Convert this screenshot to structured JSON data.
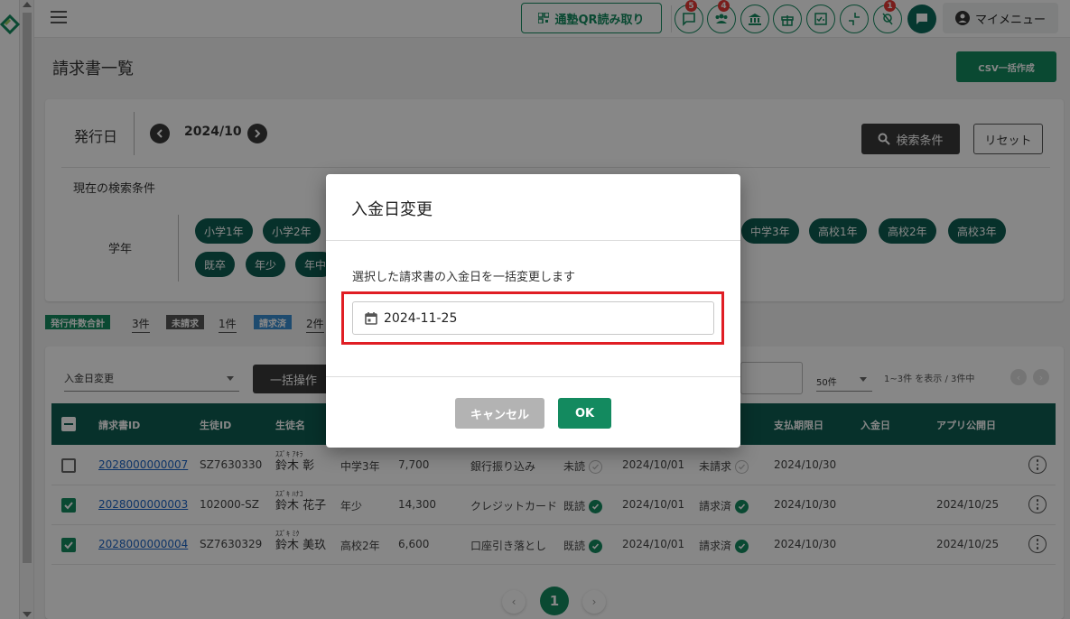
{
  "header": {
    "qr_button": "通塾QR読み取り",
    "badges": {
      "messages": "5",
      "users": "4",
      "alerts": "1"
    },
    "my_menu": "マイメニュー"
  },
  "page": {
    "title": "請求書一覧",
    "csv_button": "CSV一括作成"
  },
  "filters": {
    "issue_date_label": "発行日",
    "month": "2024/10",
    "search_button": "検索条件",
    "reset_button": "リセット",
    "current_conditions_label": "現在の検索条件",
    "grade_label": "学年",
    "chips_row1": [
      "小学1年",
      "小学2年",
      "中学3年",
      "高校1年",
      "高校2年",
      "高校3年"
    ],
    "chips_row2": [
      "既卒",
      "年少",
      "年中"
    ]
  },
  "summary": {
    "issued_label": "発行件数合計",
    "issued_value": "3件",
    "unbilled_label": "未請求",
    "unbilled_value": "1件",
    "billed_label": "請求済",
    "billed_value": "2件"
  },
  "list": {
    "action_select": "入金日変更",
    "bulk_button": "一括操作",
    "per_page": "50件",
    "range_text": "1~3件 を表示 / 3件中",
    "columns": {
      "invoice_id": "請求書ID",
      "student_id": "生徒ID",
      "student_name": "生徒名",
      "due_date": "支払期限日",
      "paid_date": "入金日",
      "app_date": "アプリ公開日"
    },
    "rows": [
      {
        "invoice_id": "2028000000007",
        "student_id": "SZ7630330",
        "kana": "ｽｽﾞｷ ｱｷﾗ",
        "name": "鈴木 彰",
        "grade": "中学3年",
        "amount": "7,700",
        "method": "銀行振り込み",
        "read": "未読",
        "issue": "2024/10/01",
        "status": "未請求",
        "due": "2024/10/30",
        "app_date": ""
      },
      {
        "invoice_id": "2028000000003",
        "student_id": "102000-SZ",
        "kana": "ｽｽﾞｷ ﾊﾅｺ",
        "name": "鈴木 花子",
        "grade": "年少",
        "amount": "14,300",
        "method": "クレジットカード",
        "read": "既読",
        "issue": "2024/10/01",
        "status": "請求済",
        "due": "2024/10/30",
        "app_date": "2024/10/25"
      },
      {
        "invoice_id": "2028000000004",
        "student_id": "SZ7630329",
        "kana": "ｽｽﾞｷ ﾐｸ",
        "name": "鈴木 美玖",
        "grade": "高校2年",
        "amount": "6,600",
        "method": "口座引き落とし",
        "read": "既読",
        "issue": "2024/10/01",
        "status": "請求済",
        "due": "2024/10/30",
        "app_date": "2024/10/25"
      }
    ],
    "current_page": "1"
  },
  "modal": {
    "title": "入金日変更",
    "description": "選択した請求書の入金日を一括変更します",
    "date_value": "2024-11-25",
    "cancel_button": "キャンセル",
    "ok_button": "OK"
  },
  "colors": {
    "brand_green": "#138a5f",
    "dark_teal": "#0f5d52",
    "highlight_red": "#e01e24"
  }
}
